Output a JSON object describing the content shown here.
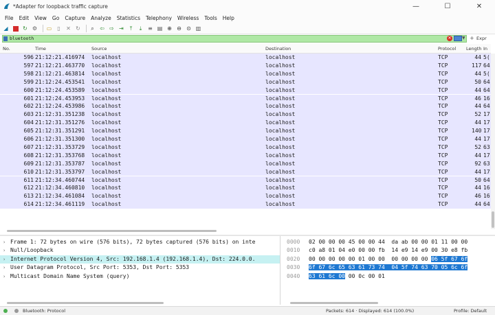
{
  "window": {
    "title": "*Adapter for loopback traffic capture",
    "controls": {
      "minimize": "—",
      "maximize": "☐",
      "close": "✕"
    }
  },
  "menu": [
    "File",
    "Edit",
    "View",
    "Go",
    "Capture",
    "Analyze",
    "Statistics",
    "Telephony",
    "Wireless",
    "Tools",
    "Help"
  ],
  "filter": {
    "value": "bluetooth",
    "expression_label": "Expr",
    "colors": {
      "valid_background": "#afe8a5"
    }
  },
  "columns": [
    "No.",
    "Time",
    "Source",
    "Destination",
    "Protocol",
    "Length",
    "In"
  ],
  "packets": [
    {
      "no": "596",
      "time": "21:12:21.416974",
      "src": "localhost",
      "dst": "localhost",
      "proto": "TCP",
      "len": "44",
      "info": "5("
    },
    {
      "no": "597",
      "time": "21:12:21.463770",
      "src": "localhost",
      "dst": "localhost",
      "proto": "TCP",
      "len": "117",
      "info": "64"
    },
    {
      "no": "598",
      "time": "21:12:21.463814",
      "src": "localhost",
      "dst": "localhost",
      "proto": "TCP",
      "len": "44",
      "info": "5("
    },
    {
      "no": "599",
      "time": "21:12:24.453541",
      "src": "localhost",
      "dst": "localhost",
      "proto": "TCP",
      "len": "50",
      "info": "64"
    },
    {
      "no": "600",
      "time": "21:12:24.453589",
      "src": "localhost",
      "dst": "localhost",
      "proto": "TCP",
      "len": "44",
      "info": "64"
    },
    {
      "no": "601",
      "time": "21:12:24.453953",
      "src": "localhost",
      "dst": "localhost",
      "proto": "TCP",
      "len": "46",
      "info": "16"
    },
    {
      "no": "602",
      "time": "21:12:24.453986",
      "src": "localhost",
      "dst": "localhost",
      "proto": "TCP",
      "len": "44",
      "info": "64"
    },
    {
      "no": "603",
      "time": "21:12:31.351238",
      "src": "localhost",
      "dst": "localhost",
      "proto": "TCP",
      "len": "52",
      "info": "17"
    },
    {
      "no": "604",
      "time": "21:12:31.351276",
      "src": "localhost",
      "dst": "localhost",
      "proto": "TCP",
      "len": "44",
      "info": "17"
    },
    {
      "no": "605",
      "time": "21:12:31.351291",
      "src": "localhost",
      "dst": "localhost",
      "proto": "TCP",
      "len": "140",
      "info": "17"
    },
    {
      "no": "606",
      "time": "21:12:31.351300",
      "src": "localhost",
      "dst": "localhost",
      "proto": "TCP",
      "len": "44",
      "info": "17"
    },
    {
      "no": "607",
      "time": "21:12:31.353729",
      "src": "localhost",
      "dst": "localhost",
      "proto": "TCP",
      "len": "52",
      "info": "63"
    },
    {
      "no": "608",
      "time": "21:12:31.353768",
      "src": "localhost",
      "dst": "localhost",
      "proto": "TCP",
      "len": "44",
      "info": "17"
    },
    {
      "no": "609",
      "time": "21:12:31.353787",
      "src": "localhost",
      "dst": "localhost",
      "proto": "TCP",
      "len": "92",
      "info": "63"
    },
    {
      "no": "610",
      "time": "21:12:31.353797",
      "src": "localhost",
      "dst": "localhost",
      "proto": "TCP",
      "len": "44",
      "info": "17"
    },
    {
      "no": "611",
      "time": "21:12:34.460744",
      "src": "localhost",
      "dst": "localhost",
      "proto": "TCP",
      "len": "50",
      "info": "64"
    },
    {
      "no": "612",
      "time": "21:12:34.460810",
      "src": "localhost",
      "dst": "localhost",
      "proto": "TCP",
      "len": "44",
      "info": "16"
    },
    {
      "no": "613",
      "time": "21:12:34.461084",
      "src": "localhost",
      "dst": "localhost",
      "proto": "TCP",
      "len": "46",
      "info": "16"
    },
    {
      "no": "614",
      "time": "21:12:34.461119",
      "src": "localhost",
      "dst": "localhost",
      "proto": "TCP",
      "len": "44",
      "info": "64"
    }
  ],
  "details": [
    {
      "text": "Frame 1: 72 bytes on wire (576 bits), 72 bytes captured (576 bits) on inte",
      "selected": false
    },
    {
      "text": "Null/Loopback",
      "selected": false
    },
    {
      "text": "Internet Protocol Version 4, Src: 192.168.1.4 (192.168.1.4), Dst: 224.0.0.",
      "selected": true
    },
    {
      "text": "User Datagram Protocol, Src Port: 5353, Dst Port: 5353",
      "selected": false
    },
    {
      "text": "Multicast Domain Name System (query)",
      "selected": false
    }
  ],
  "bytes": [
    {
      "offset": "0000",
      "hex": "02 00 00 00 45 00 00 44  da ab 00 00 01 11 00 00",
      "hl": ""
    },
    {
      "offset": "0010",
      "hex": "c0 a8 01 04 e0 00 00 fb  14 e9 14 e9 00 30 e8 fb",
      "hl": ""
    },
    {
      "offset": "0020",
      "hex": "00 00 00 00 00 01 00 00  00 00 00 00 ",
      "hl": "06 5f 67 6f"
    },
    {
      "offset": "0030",
      "hex": "",
      "hl": "6f 67 6c 65 63 61 73 74  04 5f 74 63 70 05 6c 6f"
    },
    {
      "offset": "0040",
      "hex": " 00 0c 00 01",
      "hl": "63 61 6c 00",
      "hl_first": true
    }
  ],
  "status": {
    "profile_field": "Bluetooth: Protocol",
    "packets": "Packets: 614 · Displayed: 614 (100.0%)",
    "profile": "Profile: Default"
  }
}
